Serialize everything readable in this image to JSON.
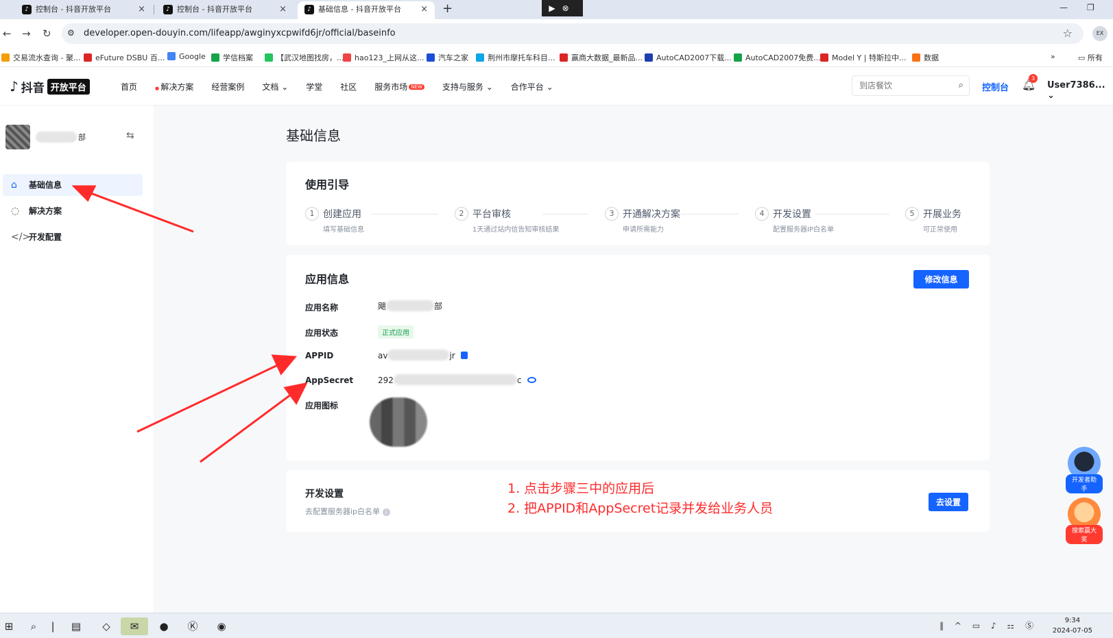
{
  "browser": {
    "tabs": [
      {
        "title": "控制台 - 抖音开放平台",
        "active": false
      },
      {
        "title": "控制台 - 抖音开放平台",
        "active": false
      },
      {
        "title": "基础信息 - 抖音开放平台",
        "active": true
      }
    ],
    "url": "developer.open-douyin.com/lifeapp/awginyxcpwifd6jr/official/baseinfo",
    "profile_label": "EX",
    "bookmarks": [
      {
        "label": "交易流水查询 - 聚...",
        "color": "#f59e0b"
      },
      {
        "label": "eFuture DSBU 百...",
        "color": "#dc2626"
      },
      {
        "label": "Google",
        "color": "#4285f4"
      },
      {
        "label": "学信档案",
        "color": "#16a34a"
      },
      {
        "label": "【武汉地图找房，...",
        "color": "#22c55e"
      },
      {
        "label": "hao123_上网从这...",
        "color": "#ef4444"
      },
      {
        "label": "汽车之家",
        "color": "#1d4ed8"
      },
      {
        "label": "荆州市摩托车科目...",
        "color": "#0ea5e9"
      },
      {
        "label": "赢商大数据_最新品...",
        "color": "#dc2626"
      },
      {
        "label": "AutoCAD2007下载...",
        "color": "#1e40af"
      },
      {
        "label": "AutoCAD2007免费...",
        "color": "#16a34a"
      },
      {
        "label": "Model Y | 特斯拉中...",
        "color": "#dc2626"
      },
      {
        "label": "数据",
        "color": "#f97316"
      }
    ],
    "bookmarks_more": "»",
    "all_bookmarks": "所有"
  },
  "site": {
    "brand": "抖音",
    "brand_tag": "开放平台",
    "nav": [
      {
        "label": "首页"
      },
      {
        "label": "解决方案",
        "dot": true
      },
      {
        "label": "经营案例"
      },
      {
        "label": "文档 ⌄"
      },
      {
        "label": "学堂"
      },
      {
        "label": "社区"
      },
      {
        "label": "服务市场",
        "badge": "NEW"
      },
      {
        "label": "支持与服务 ⌄"
      },
      {
        "label": "合作平台 ⌄"
      }
    ],
    "search_placeholder": "到店餐饮",
    "console_label": "控制台",
    "notification_count": "3",
    "user_name": "User7386... ⌄"
  },
  "sidebar": {
    "app_name_suffix": "部",
    "items": [
      {
        "label": "基础信息",
        "icon": "home-icon",
        "active": true
      },
      {
        "label": "解决方案",
        "icon": "bulb-icon",
        "active": false
      },
      {
        "label": "开发配置",
        "icon": "code-icon",
        "active": false
      }
    ]
  },
  "main": {
    "page_title": "基础信息",
    "guide": {
      "title": "使用引导",
      "steps": [
        {
          "num": "1",
          "title": "创建应用",
          "desc": "填写基础信息"
        },
        {
          "num": "2",
          "title": "平台审核",
          "desc": "1天通过站内信告知审核结果"
        },
        {
          "num": "3",
          "title": "开通解决方案",
          "desc": "申请所需能力"
        },
        {
          "num": "4",
          "title": "开发设置",
          "desc": "配置服务器IP白名单"
        },
        {
          "num": "5",
          "title": "开展业务",
          "desc": "可正常使用"
        }
      ]
    },
    "app_info": {
      "title": "应用信息",
      "edit_button": "修改信息",
      "labels": {
        "name": "应用名称",
        "status": "应用状态",
        "appid": "APPID",
        "secret": "AppSecret",
        "icon": "应用图标"
      },
      "name_prefix": "飓",
      "name_suffix": "部",
      "status_value": "正式应用",
      "appid_prefix": "av",
      "appid_suffix": "jr",
      "secret_prefix": "292",
      "secret_suffix": "c"
    },
    "dev_settings": {
      "title": "开发设置",
      "subtitle": "去配置服务器ip白名单",
      "button": "去设置"
    },
    "annotation": {
      "line1": "1. 点击步骤三中的应用后",
      "line2": "2. 把APPID和AppSecret记录并发给业务人员"
    }
  },
  "floating": {
    "assistant_label": "开发者助手",
    "prize_label": "搜索赢大奖"
  },
  "taskbar": {
    "time": "9:34",
    "date": "2024-07-05"
  },
  "colors": {
    "accent": "#1664ff",
    "annotation": "#ff2b2b",
    "status_green": "#1aa356"
  }
}
